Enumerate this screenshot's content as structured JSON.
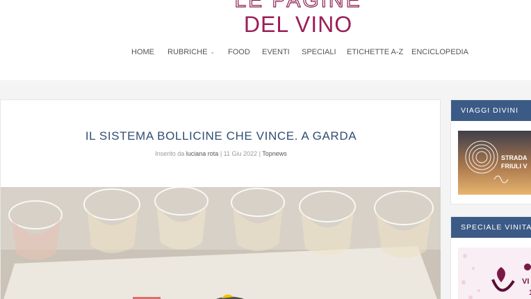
{
  "site": {
    "logo_top": "LE PAGINE",
    "logo_main": "DEL VINO",
    "brand_color": "#9b1f56"
  },
  "nav": {
    "items": [
      {
        "label": "HOME"
      },
      {
        "label": "RUBRICHE",
        "has_dropdown": true
      },
      {
        "label": "FOOD"
      },
      {
        "label": "EVENTI"
      },
      {
        "label": "SPECIALI"
      },
      {
        "label": "ETICHETTE A-Z"
      },
      {
        "label": "ENCICLOPEDIA"
      }
    ]
  },
  "post": {
    "title": "IL SISTEMA BOLLICINE CHE VINCE. A GARDA",
    "meta_prefix": "Inserito da",
    "author": "luciana rota",
    "separator": "|",
    "date": "11 Giu 2022",
    "category": "Topnews",
    "title_color": "#2f4d74"
  },
  "sidebar": {
    "widgets": [
      {
        "title": "VIAGGI DIVINI",
        "image_text": "STRADA FRIULI V"
      },
      {
        "title": "SPECIALE VINITALY",
        "image_text": "VI 1"
      }
    ],
    "header_color": "#3b5b86"
  }
}
